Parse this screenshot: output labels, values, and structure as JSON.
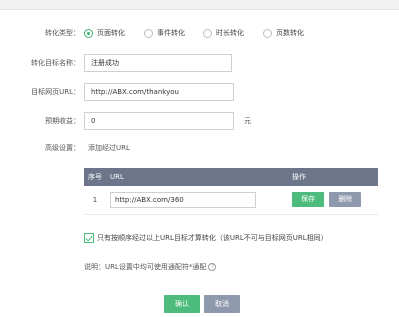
{
  "labels": {
    "conversion_type": "转化类型：",
    "target_name": "转化目标名称：",
    "target_url": "目标网页URL：",
    "expected_revenue": "预期收益：",
    "advanced": "高级设置："
  },
  "radios": [
    {
      "label": "页面转化",
      "selected": true
    },
    {
      "label": "事件转化",
      "selected": false
    },
    {
      "label": "时长转化",
      "selected": false
    },
    {
      "label": "页数转化",
      "selected": false
    }
  ],
  "fields": {
    "target_name_value": "注册成功",
    "target_url_value": "http://ABX.com/thankyou",
    "revenue_value": "0",
    "revenue_unit": "元"
  },
  "advanced_link": "添加经过URL",
  "url_table": {
    "headers": {
      "index": "序号",
      "url": "URL",
      "action": "操作"
    },
    "rows": [
      {
        "index": "1",
        "url": "http://ABX.com/360",
        "save": "保存",
        "delete": "删除"
      }
    ]
  },
  "checkbox_label": "只有按顺序经过以上URL目标才算转化（该URL不可与目标网页URL相同）",
  "note": "说明：URL设置中均可使用通配符*通配",
  "buttons": {
    "confirm": "确认",
    "cancel": "取消"
  },
  "colors": {
    "accent": "#4cbb7b",
    "header": "#6c7589",
    "secondary": "#8f99ad"
  }
}
